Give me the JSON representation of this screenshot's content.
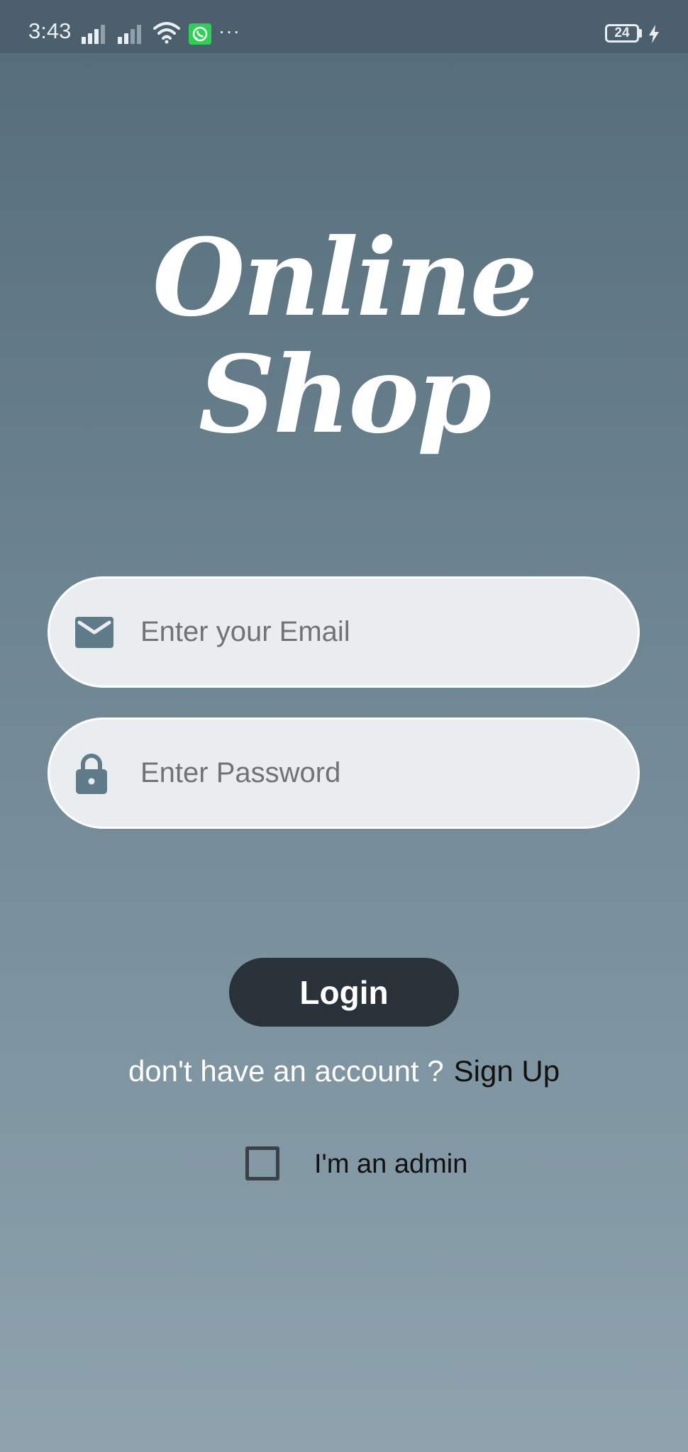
{
  "status_bar": {
    "time": "3:43",
    "battery_level": "24",
    "more_indicator": "···"
  },
  "app": {
    "title": "Online Shop"
  },
  "email_field": {
    "placeholder": "Enter your Email",
    "value": "",
    "icon": "envelope-icon"
  },
  "password_field": {
    "placeholder": "Enter Password",
    "value": "",
    "icon": "lock-icon"
  },
  "login_button": {
    "label": "Login"
  },
  "signup": {
    "prompt": "don't have an account ?",
    "link_label": "Sign Up"
  },
  "admin_option": {
    "label": "I'm an admin",
    "checked": false
  },
  "colors": {
    "background_top": "#546b78",
    "background_bottom": "#8ea3ae",
    "field_background": "#eaedf0",
    "icon_color": "#5f7a89",
    "button_background": "#283238",
    "whatsapp_green": "#2fd057"
  }
}
